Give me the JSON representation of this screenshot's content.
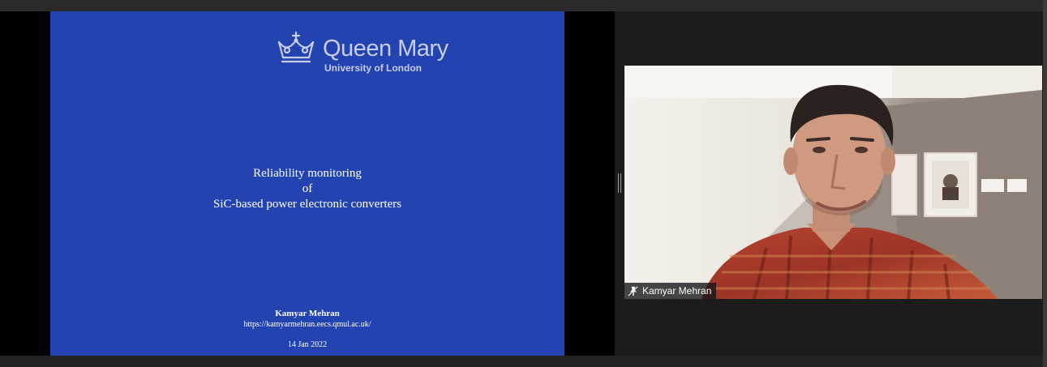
{
  "slide": {
    "logo_name": "Queen Mary",
    "logo_subtitle": "University of London",
    "title_line1": "Reliability monitoring",
    "title_line2": "of",
    "title_line3": "SiC-based power electronic converters",
    "author": "Kamyar Mehran",
    "url": "https://kamyarmehran.eecs.qmul.ac.uk/",
    "date": "14 Jan 2022"
  },
  "participant": {
    "name": "Kamyar Mehran",
    "status_icon": "pin-icon"
  },
  "colors": {
    "slide_background": "#2344b0",
    "slide_text": "#ffffff",
    "logo_text": "#c7cde4",
    "app_background": "#1c1c1c"
  }
}
